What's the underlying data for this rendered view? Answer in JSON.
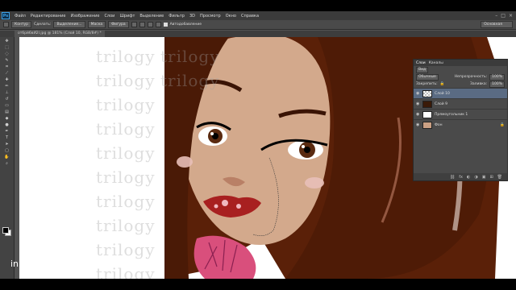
{
  "app": {
    "logo": "Ps",
    "menu": [
      "Файл",
      "Редактирование",
      "Изображение",
      "Слои",
      "Шрифт",
      "Выделение",
      "Фильтр",
      "3D",
      "Просмотр",
      "Окно",
      "Справка"
    ],
    "window_controls": [
      "–",
      "□",
      "×"
    ]
  },
  "options": {
    "tool_label": "Контур",
    "buttons": [
      "Сделать:",
      "Выделение...",
      "Маска",
      "Фигура"
    ],
    "autoadd_label": "Автодобавление",
    "workspace": "Основная"
  },
  "document": {
    "tab_label": "отбрй6вИ2l.jpg @ 181% (Слой 10, RGB/8#) *"
  },
  "canvas": {
    "watermark": "trilogy"
  },
  "layers_panel": {
    "tabs": [
      "Слои",
      "Каналы"
    ],
    "kind_label": "Вид",
    "blend_mode": "Обычные",
    "opacity_label": "Непрозрачность:",
    "opacity_value": "100%",
    "lock_label": "Закрепить:",
    "fill_label": "Заливка:",
    "fill_value": "100%",
    "layers": [
      {
        "name": "Слой 10",
        "selected": true
      },
      {
        "name": "Слой 9",
        "selected": false
      },
      {
        "name": "Прямоугольник 1",
        "selected": false
      },
      {
        "name": "Фон",
        "selected": false
      }
    ]
  },
  "caption": "in"
}
